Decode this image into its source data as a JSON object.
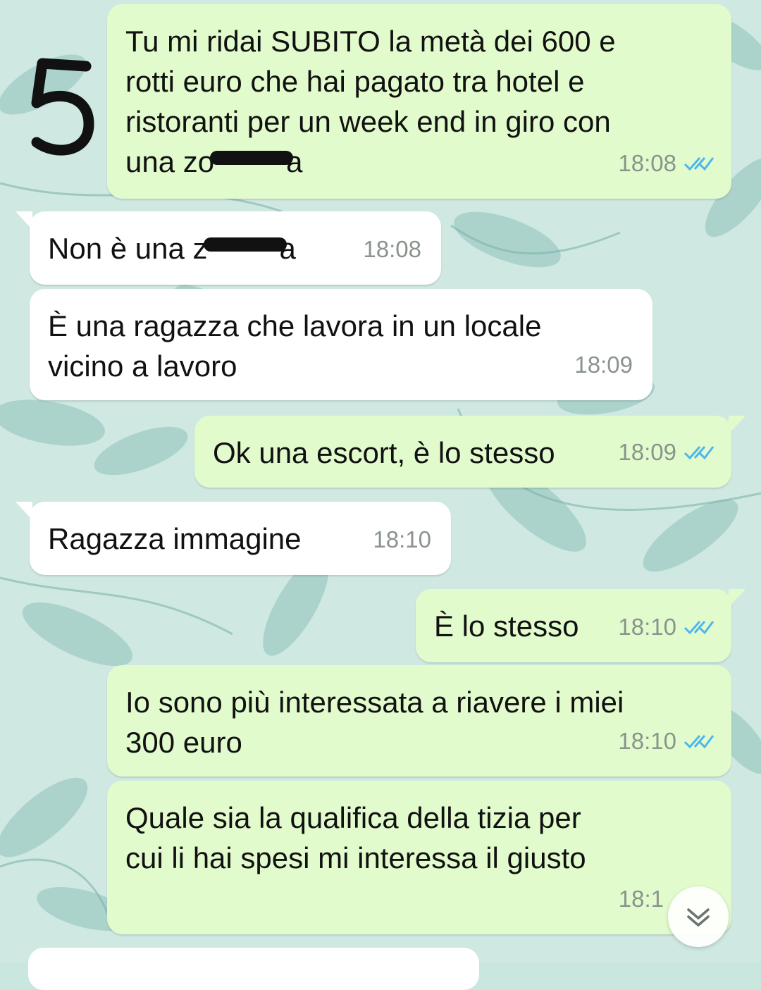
{
  "annotation": {
    "number": "5"
  },
  "messages": [
    {
      "direction": "outgoing",
      "text_before": "Tu mi ridai SUBITO la metà dei 600 e\nrotti euro che hai pagato tra hotel e\nristoranti per un week end in giro con\nuna zo",
      "text_after": "a",
      "time": "18:08",
      "status": "read"
    },
    {
      "direction": "incoming",
      "text_before": "Non è una z",
      "text_after": "a",
      "time": "18:08"
    },
    {
      "direction": "incoming",
      "text": "È una ragazza che lavora in un locale\nvicino a lavoro",
      "time": "18:09"
    },
    {
      "direction": "outgoing",
      "text": "Ok una escort, è lo stesso",
      "time": "18:09",
      "status": "read"
    },
    {
      "direction": "incoming",
      "text": "Ragazza immagine",
      "time": "18:10"
    },
    {
      "direction": "outgoing",
      "text": "È lo stesso",
      "time": "18:10",
      "status": "read"
    },
    {
      "direction": "outgoing",
      "text": "Io sono più interessata a riavere i miei\n300 euro",
      "time": "18:10",
      "status": "read"
    },
    {
      "direction": "outgoing",
      "text": "Quale sia la qualifica della tizia per\ncui li hai spesi mi interessa il giusto",
      "time": "18:1",
      "status": "read"
    }
  ],
  "colors": {
    "outgoing_bubble": "#e2fbcd",
    "incoming_bubble": "#ffffff",
    "read_ticks": "#4fb6ec",
    "wallpaper": "#c9e6df",
    "leaf": "#8fc2bd"
  },
  "icons": {
    "scroll_down": "chevron-down-icon",
    "read_receipt": "double-check-icon"
  }
}
